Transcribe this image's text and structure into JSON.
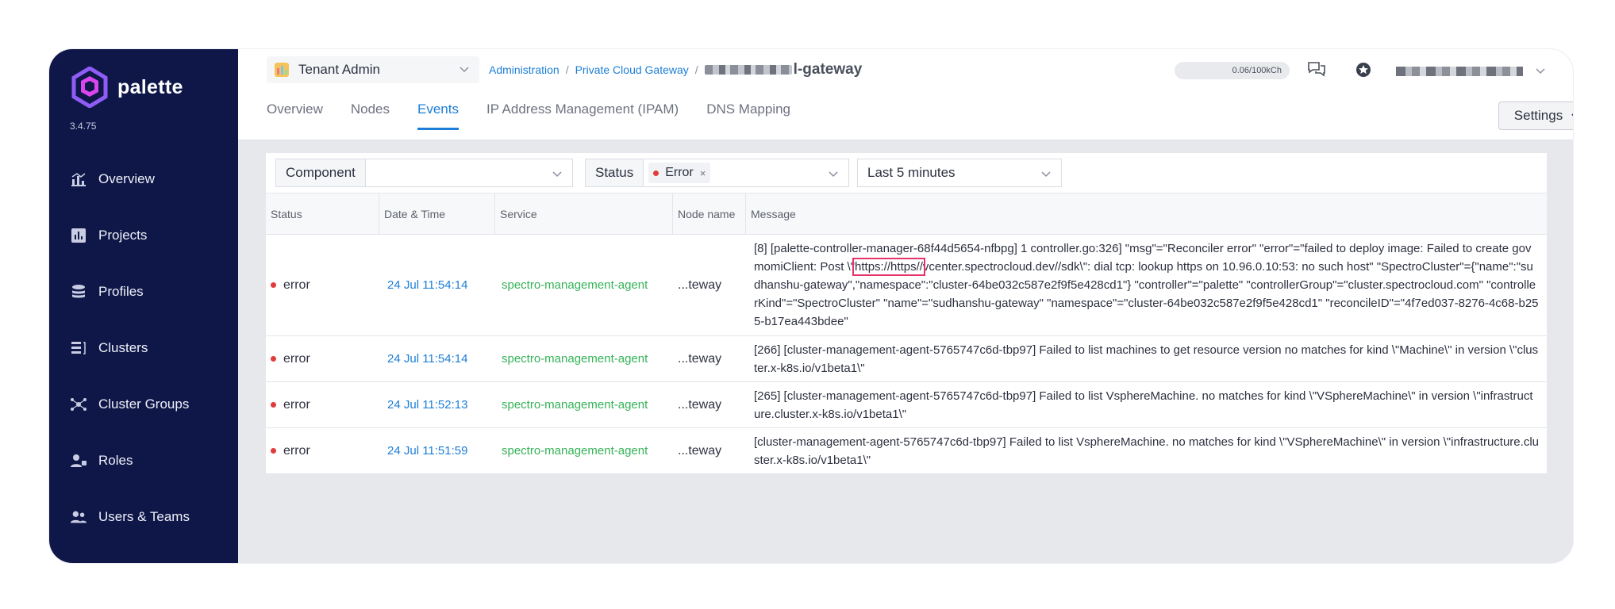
{
  "sidebar": {
    "brand": "palette",
    "version": "3.4.75",
    "items": [
      {
        "label": "Overview",
        "icon": "overview-icon"
      },
      {
        "label": "Projects",
        "icon": "projects-icon"
      },
      {
        "label": "Profiles",
        "icon": "profiles-icon"
      },
      {
        "label": "Clusters",
        "icon": "clusters-icon"
      },
      {
        "label": "Cluster Groups",
        "icon": "cluster-groups-icon"
      },
      {
        "label": "Roles",
        "icon": "roles-icon"
      },
      {
        "label": "Users & Teams",
        "icon": "users-teams-icon"
      }
    ]
  },
  "header": {
    "tenant": "Tenant Admin",
    "breadcrumb": {
      "admin": "Administration",
      "sep": "/",
      "pcg": "Private Cloud Gateway",
      "current": "l-gateway"
    },
    "credit": "0.06/100kCh"
  },
  "tabs": [
    "Overview",
    "Nodes",
    "Events",
    "IP Address Management (IPAM)",
    "DNS Mapping"
  ],
  "active_tab": "Events",
  "settings_label": "Settings",
  "filters": {
    "component_label": "Component",
    "status_label": "Status",
    "status_tag": "Error",
    "status_tag_close": "×",
    "time_range": "Last 5 minutes"
  },
  "table": {
    "columns": [
      "Status",
      "Date & Time",
      "Service",
      "Node name",
      "Message"
    ],
    "rows": [
      {
        "status": "error",
        "date": "24 Jul 11:54:14",
        "service": "spectro-management-agent",
        "node": "...teway",
        "message_pre": "[8] [palette-controller-manager-68f44d5654-nfbpg] 1 controller.go:326] \"msg\"=\"Reconciler error\" \"error\"=\"failed to deploy image: Failed to create govmomiClient: Post \\\"",
        "message_hl": "https://https//",
        "message_post": "vcenter.spectrocloud.dev//sdk\\\": dial tcp: lookup https on 10.96.0.10:53: no such host\" \"SpectroCluster\"={\"name\":\"sudhanshu-gateway\",\"namespace\":\"cluster-64be032c587e2f9f5e428cd1\"} \"controller\"=\"palette\" \"controllerGroup\"=\"cluster.spectrocloud.com\" \"controllerKind\"=\"SpectroCluster\" \"name\"=\"sudhanshu-gateway\" \"namespace\"=\"cluster-64be032c587e2f9f5e428cd1\" \"reconcileID\"=\"4f7ed037-8276-4c68-b255-b17ea443bdee\""
      },
      {
        "status": "error",
        "date": "24 Jul 11:54:14",
        "service": "spectro-management-agent",
        "node": "...teway",
        "message_pre": "[266] [cluster-management-agent-5765747c6d-tbp97] Failed to list machines to get resource version no matches for kind \\\"Machine\\\" in version \\\"cluster.x-k8s.io/v1beta1\\\"",
        "message_hl": "",
        "message_post": ""
      },
      {
        "status": "error",
        "date": "24 Jul 11:52:13",
        "service": "spectro-management-agent",
        "node": "...teway",
        "message_pre": "[265] [cluster-management-agent-5765747c6d-tbp97] Failed to list VsphereMachine. no matches for kind \\\"VSphereMachine\\\" in version \\\"infrastructure.cluster.x-k8s.io/v1beta1\\\"",
        "message_hl": "",
        "message_post": ""
      },
      {
        "status": "error",
        "date": "24 Jul 11:51:59",
        "service": "spectro-management-agent",
        "node": "...teway",
        "message_pre": "[cluster-management-agent-5765747c6d-tbp97] Failed to list VsphereMachine. no matches for kind \\\"VSphereMachine\\\" in version \\\"infrastructure.cluster.x-k8s.io/v1beta1\\\"",
        "message_hl": "",
        "message_post": ""
      }
    ]
  },
  "colors": {
    "sidebar": "#0f1749",
    "accent": "#1c7ed6",
    "service": "#34b257",
    "error": "#e23b3b",
    "highlight": "#e8336a"
  }
}
